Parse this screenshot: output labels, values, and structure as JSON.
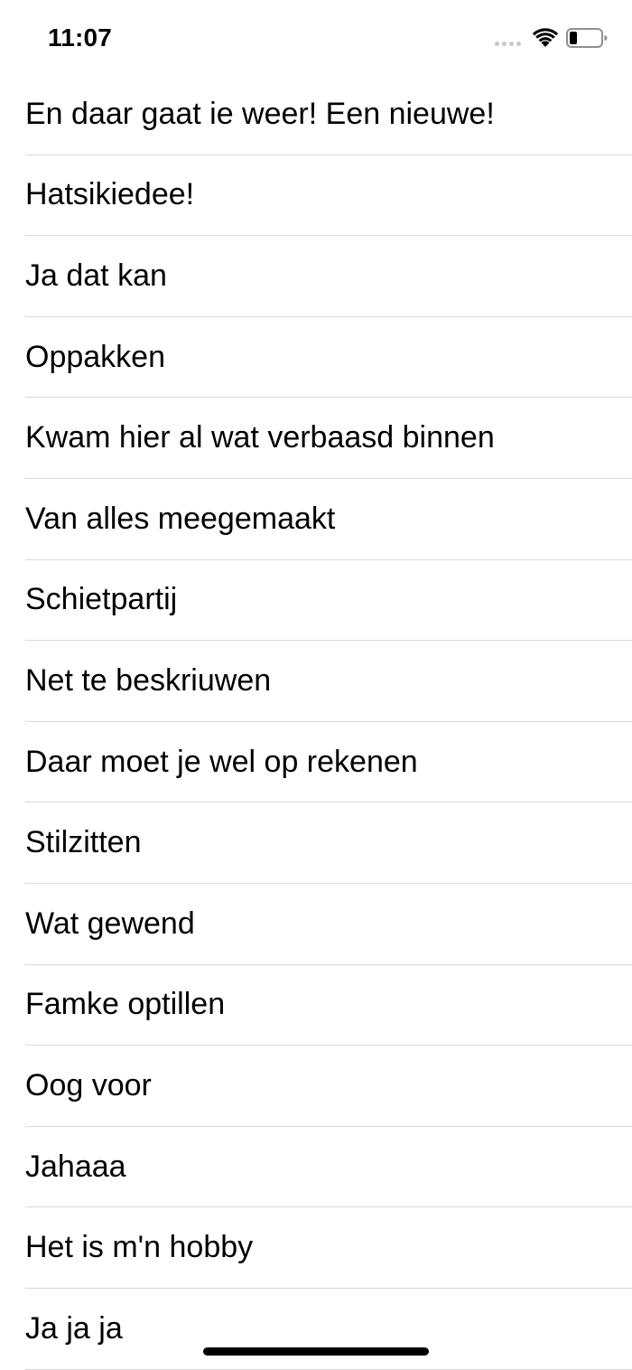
{
  "status_bar": {
    "time": "11:07",
    "icons": [
      "signal-dots-icon",
      "wifi-icon",
      "battery-icon"
    ]
  },
  "list": {
    "items": [
      "En daar gaat ie weer! Een nieuwe!",
      "Hatsikiedee!",
      "Ja dat kan",
      "Oppakken",
      "Kwam hier al wat verbaasd binnen",
      "Van alles meegemaakt",
      "Schietpartij",
      "Net te beskriuwen",
      "Daar moet je wel op rekenen",
      "Stilzitten",
      "Wat gewend",
      "Famke optillen",
      "Oog voor",
      "Jahaaa",
      "Het is m'n hobby",
      "Ja ja ja"
    ]
  },
  "colors": {
    "background": "#ffffff",
    "text": "#000000",
    "separator": "#d9d9dc",
    "signal_inactive": "#c7c7cc"
  }
}
